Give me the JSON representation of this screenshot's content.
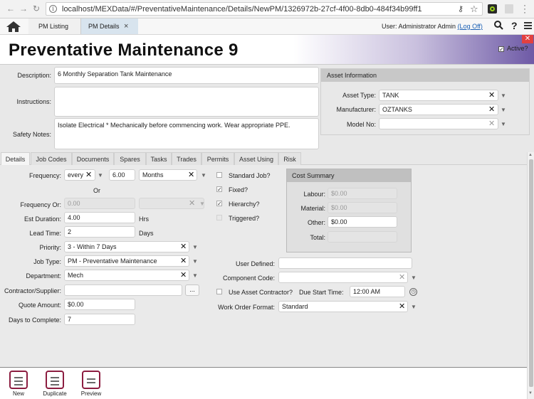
{
  "browser": {
    "url": "localhost/MEXData/#/PreventativeMaintenance/Details/NewPM/1326972b-27cf-4f00-8db0-484f34b99ff1"
  },
  "header": {
    "tabs": [
      {
        "label": "PM Listing"
      },
      {
        "label": "PM Details",
        "close": "×"
      }
    ],
    "user_prefix": "User: Administrator Admin",
    "logoff": "(Log Off)"
  },
  "page": {
    "title": "Preventative Maintenance",
    "number": "9",
    "active_label": "Active?",
    "active_checked": true
  },
  "form": {
    "description_label": "Description:",
    "description": "6 Monthly Separation Tank Maintenance",
    "instructions_label": "Instructions:",
    "instructions": "",
    "safety_label": "Safety Notes:",
    "safety": "Isolate Electrical * Mechanically before commencing work. Wear appropriate PPE."
  },
  "asset_info": {
    "heading": "Asset Information",
    "asset_type_label": "Asset Type:",
    "asset_type": "TANK",
    "manufacturer_label": "Manufacturer:",
    "manufacturer": "OZTANKS",
    "model_label": "Model No:",
    "model": ""
  },
  "tabs": [
    "Details",
    "Job Codes",
    "Documents",
    "Spares",
    "Tasks",
    "Trades",
    "Permits",
    "Asset Using",
    "Risk"
  ],
  "details": {
    "frequency_label": "Frequency:",
    "frequency_mode": "every",
    "frequency_value": "6.00",
    "frequency_unit": "Months",
    "or_label": "Or",
    "frequency_or_label": "Frequency Or:",
    "frequency_or_value": "0.00",
    "est_duration_label": "Est Duration:",
    "est_duration": "4.00",
    "est_duration_unit": "Hrs",
    "lead_time_label": "Lead Time:",
    "lead_time": "2",
    "lead_time_unit": "Days",
    "priority_label": "Priority:",
    "priority": "3 - Within 7 Days",
    "job_type_label": "Job Type:",
    "job_type": "PM - Preventative Maintenance",
    "department_label": "Department:",
    "department": "Mech",
    "contractor_label": "Contractor/Supplier:",
    "contractor": "",
    "dots": "...",
    "quote_label": "Quote Amount:",
    "quote": "$0.00",
    "days_label": "Days to Complete:",
    "days": "7",
    "standard_job_label": "Standard Job?",
    "fixed_label": "Fixed?",
    "hierarchy_label": "Hierarchy?",
    "triggered_label": "Triggered?",
    "user_defined_label": "User Defined:",
    "user_defined": "",
    "component_code_label": "Component Code:",
    "component_code": "",
    "use_asset_contractor_label": "Use Asset Contractor?",
    "due_start_label": "Due Start Time:",
    "due_start": "12:00 AM",
    "wo_format_label": "Work Order Format:",
    "wo_format": "Standard"
  },
  "cost_summary": {
    "heading": "Cost Summary",
    "labour_label": "Labour:",
    "labour": "$0.00",
    "material_label": "Material:",
    "material": "$0.00",
    "other_label": "Other:",
    "other": "$0.00",
    "total_label": "Total:",
    "total": ""
  },
  "toolbar": {
    "new": "New",
    "duplicate": "Duplicate",
    "preview": "Preview"
  },
  "colors": {
    "accent_maroon": "#8c1d40",
    "title_gradient_end": "#6e5aa6",
    "close_red": "#e34040",
    "link_blue": "#1a5fb4"
  }
}
